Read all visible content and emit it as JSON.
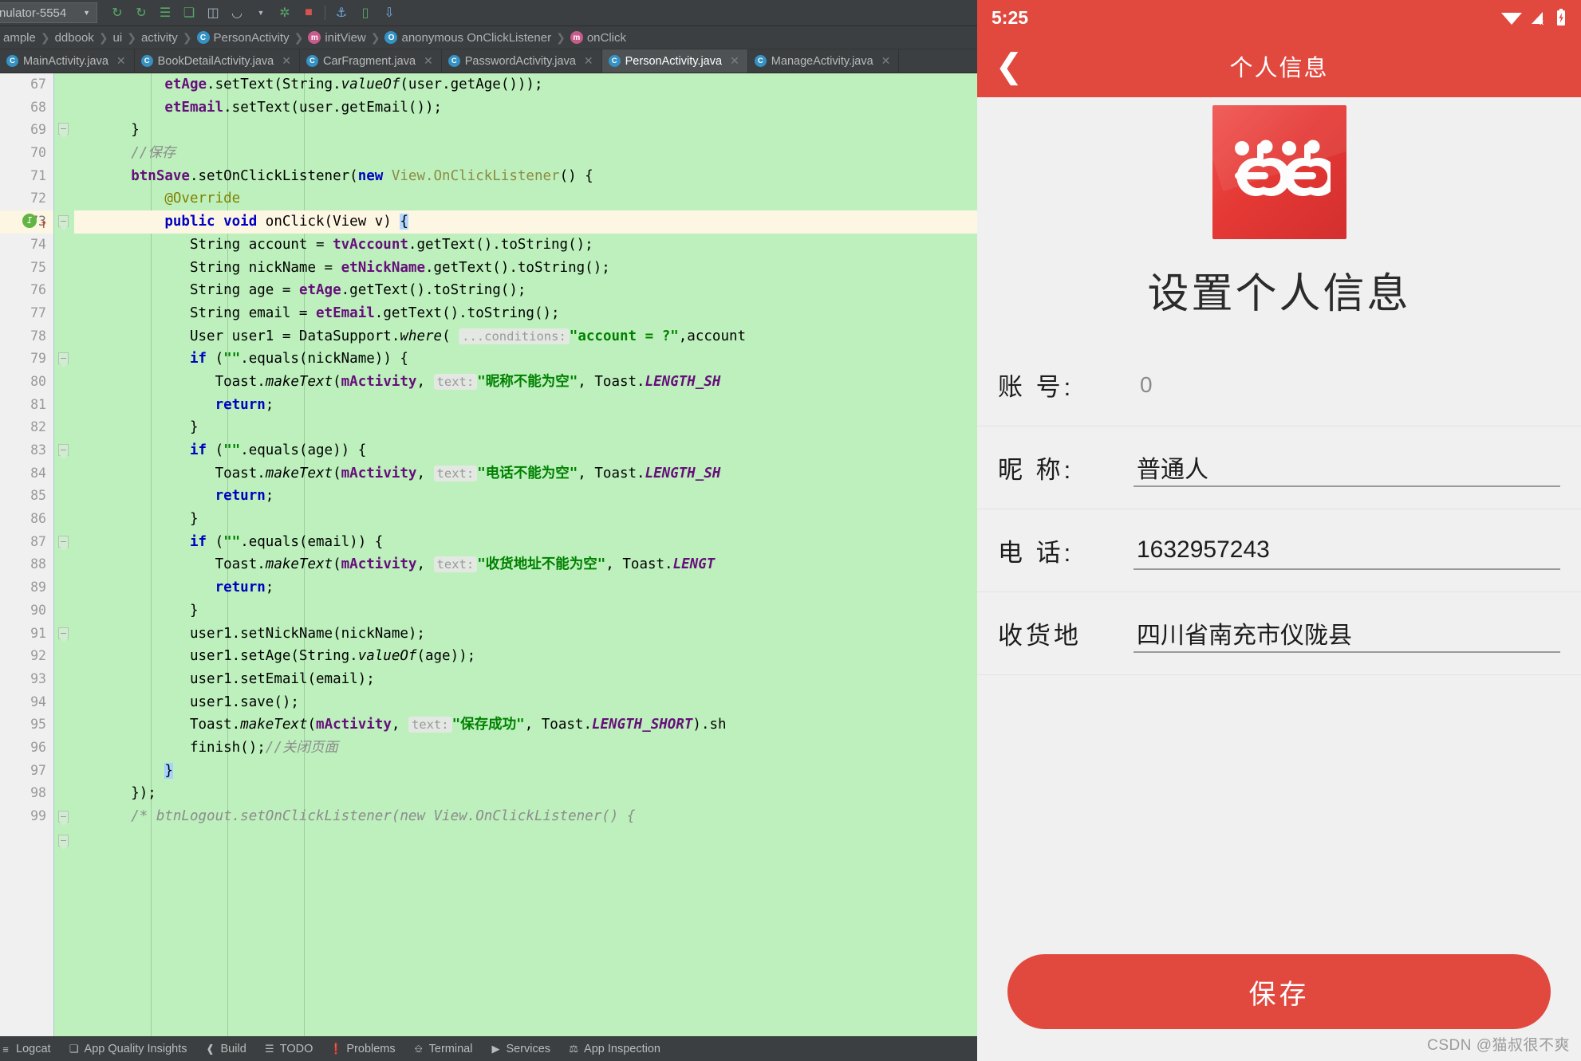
{
  "ide": {
    "toolbar": {
      "device": "nulator-5554",
      "caret": "▼",
      "icons": [
        {
          "name": "run-icon",
          "glyph": "↻"
        },
        {
          "name": "run-with-coverage-icon",
          "glyph": "↻"
        },
        {
          "name": "layout-inspector-icon",
          "glyph": "☰"
        },
        {
          "name": "debug-icon",
          "glyph": "⬟"
        },
        {
          "name": "attach-debugger-icon",
          "glyph": "⬠"
        },
        {
          "name": "profiler-icon",
          "glyph": "◖"
        },
        {
          "name": "profiler-dropdown-icon",
          "glyph": "▾"
        },
        {
          "name": "run-anything-icon",
          "glyph": "⬢"
        },
        {
          "name": "stop-icon",
          "glyph": "■"
        },
        {
          "name": "sync-gradle-icon",
          "glyph": "🐘"
        },
        {
          "name": "avd-manager-icon",
          "glyph": "▭"
        },
        {
          "name": "sdk-manager-icon",
          "glyph": "⬇"
        }
      ]
    },
    "breadcrumb": [
      {
        "name": "crumb-sample",
        "label": "ample",
        "badge": ""
      },
      {
        "name": "crumb-ddbook",
        "label": "ddbook",
        "badge": ""
      },
      {
        "name": "crumb-ui",
        "label": "ui",
        "badge": ""
      },
      {
        "name": "crumb-activity",
        "label": "activity",
        "badge": ""
      },
      {
        "name": "crumb-personactivity",
        "label": "PersonActivity",
        "badge": "C"
      },
      {
        "name": "crumb-initview",
        "label": "initView",
        "badge": "m"
      },
      {
        "name": "crumb-anonymous",
        "label": "anonymous OnClickListener",
        "badge": "O"
      },
      {
        "name": "crumb-onclick",
        "label": "onClick",
        "badge": "m"
      }
    ],
    "tabs": [
      {
        "label": "MainActivity.java",
        "active": false
      },
      {
        "label": "BookDetailActivity.java",
        "active": false
      },
      {
        "label": "CarFragment.java",
        "active": false
      },
      {
        "label": "PasswordActivity.java",
        "active": false
      },
      {
        "label": "PersonActivity.java",
        "active": true
      },
      {
        "label": "ManageActivity.java",
        "active": false
      }
    ],
    "line_numbers": [
      67,
      68,
      69,
      70,
      71,
      72,
      73,
      74,
      75,
      76,
      77,
      78,
      79,
      80,
      81,
      82,
      83,
      84,
      85,
      86,
      87,
      88,
      89,
      90,
      91,
      92,
      93,
      94,
      95,
      96,
      97,
      98,
      99
    ],
    "current_line": 73,
    "bottom_tools": [
      {
        "label": "Logcat",
        "icon": "logcat-icon",
        "glyph": "≡"
      },
      {
        "label": "App Quality Insights",
        "icon": "shield-icon",
        "glyph": "⬟"
      },
      {
        "label": "Build",
        "icon": "hammer-icon",
        "glyph": "⚒"
      },
      {
        "label": "TODO",
        "icon": "list-icon",
        "glyph": "☰"
      },
      {
        "label": "Problems",
        "icon": "warning-icon",
        "glyph": "❗"
      },
      {
        "label": "Terminal",
        "icon": "terminal-icon",
        "glyph": "⌨"
      },
      {
        "label": "Services",
        "icon": "play-circle-icon",
        "glyph": "▶"
      },
      {
        "label": "App Inspection",
        "icon": "inspect-icon",
        "glyph": "⬡"
      }
    ],
    "code": {
      "l67": "etAge.setText(String.valueOf(user.getAge()));",
      "l68": "etEmail.setText(user.getEmail());",
      "l69": "}",
      "l70": "//保存",
      "l71": "btnSave.setOnClickListener(new View.OnClickListener() {",
      "l72": "@Override",
      "l73": "public void onClick(View v) {",
      "l74": "String account = tvAccount.getText().toString();",
      "l75": "String nickName = etNickName.getText().toString();",
      "l76": "String age = etAge.getText().toString();",
      "l77": "String email = etEmail.getText().toString();",
      "l78": "User user1 = DataSupport.where( ...conditions: \"account = ?\",account",
      "l79": "if (\"\".equals(nickName)) {",
      "l80": "Toast.makeText(mActivity, text: \"昵称不能为空\", Toast.LENGTH_SH",
      "l81": "return;",
      "l82": "}",
      "l83": "if (\"\".equals(age)) {",
      "l84": "Toast.makeText(mActivity, text: \"电话不能为空\", Toast.LENGTH_SH",
      "l85": "return;",
      "l86": "}",
      "l87": "if (\"\".equals(email)) {",
      "l88": "Toast.makeText(mActivity, text: \"收货地址不能为空\", Toast.LENGT",
      "l89": "return;",
      "l90": "}",
      "l91": "user1.setNickName(nickName);",
      "l92": "user1.setAge(String.valueOf(age));",
      "l93": "user1.setEmail(email);",
      "l94": "user1.save();",
      "l95": "Toast.makeText(mActivity, text: \"保存成功\", Toast.LENGTH_SHORT).sh",
      "l96": "finish();//关闭页面",
      "l97": "}",
      "l98": "});",
      "l99": "/* btnLogout.setOnClickListener(new View.OnClickListener() {",
      "hint_conditions": "...conditions:",
      "hint_text": "text:",
      "toast_nickname": "\"昵称不能为空\"",
      "toast_phone": "\"电话不能为空\"",
      "toast_address": "\"收货地址不能为空\"",
      "toast_success": "\"保存成功\"",
      "comment_save": "//保存",
      "comment_close": "//关闭页面",
      "account_cond": "\"account = ?\""
    }
  },
  "phone": {
    "status": {
      "time": "5:25",
      "wifi_icon": "wifi-icon",
      "signal_icon": "signal-off-icon",
      "battery_icon": "battery-charging-icon"
    },
    "appbar": {
      "back_icon": "back-chevron-icon",
      "title": "个人信息"
    },
    "logo_name": "dangdang-logo",
    "page_title": "设置个人信息",
    "fields": [
      {
        "label": "账 号:",
        "value": "0",
        "readonly": true,
        "name": "account-field"
      },
      {
        "label": "昵 称:",
        "value": "普通人",
        "readonly": false,
        "name": "nickname-field"
      },
      {
        "label": "电 话:",
        "value": "1632957243",
        "readonly": false,
        "name": "phone-field"
      },
      {
        "label": "收货地",
        "value": "四川省南充市仪陇县",
        "readonly": false,
        "name": "address-field"
      }
    ],
    "save_button": "保存",
    "watermark": "CSDN @猫叔很不爽"
  },
  "colors": {
    "accent_red": "#e1493f",
    "editor_bg": "#bdf0bd",
    "ide_chrome": "#3c3f41"
  }
}
